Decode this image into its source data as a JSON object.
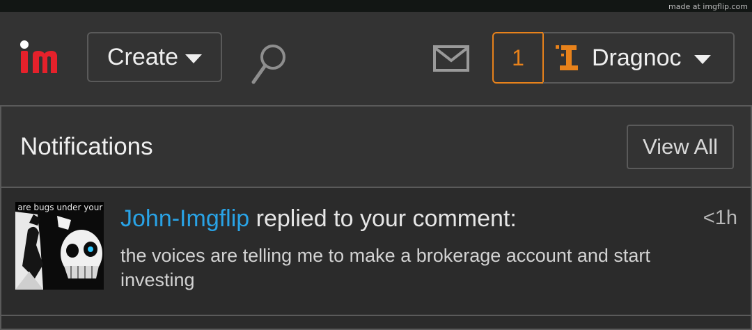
{
  "watermark": "made at imgflip.com",
  "header": {
    "logo_icon": "imgflip-logo",
    "create_label": "Create",
    "search_icon": "search-icon",
    "mail_icon": "mail-icon",
    "notification_count": "1",
    "username": "Dragnoc",
    "colors": {
      "background": "#333333",
      "accent_orange": "#e8821b",
      "logo_red": "#e5212b"
    }
  },
  "notifications": {
    "title": "Notifications",
    "view_all_label": "View All",
    "items": [
      {
        "user": "John-Imgflip",
        "action": " replied to your comment:",
        "time": "<1h",
        "text": "the voices are telling me to make a brokerage account and start investing",
        "thumbnail_caption": "e are bugs under your s"
      }
    ]
  }
}
